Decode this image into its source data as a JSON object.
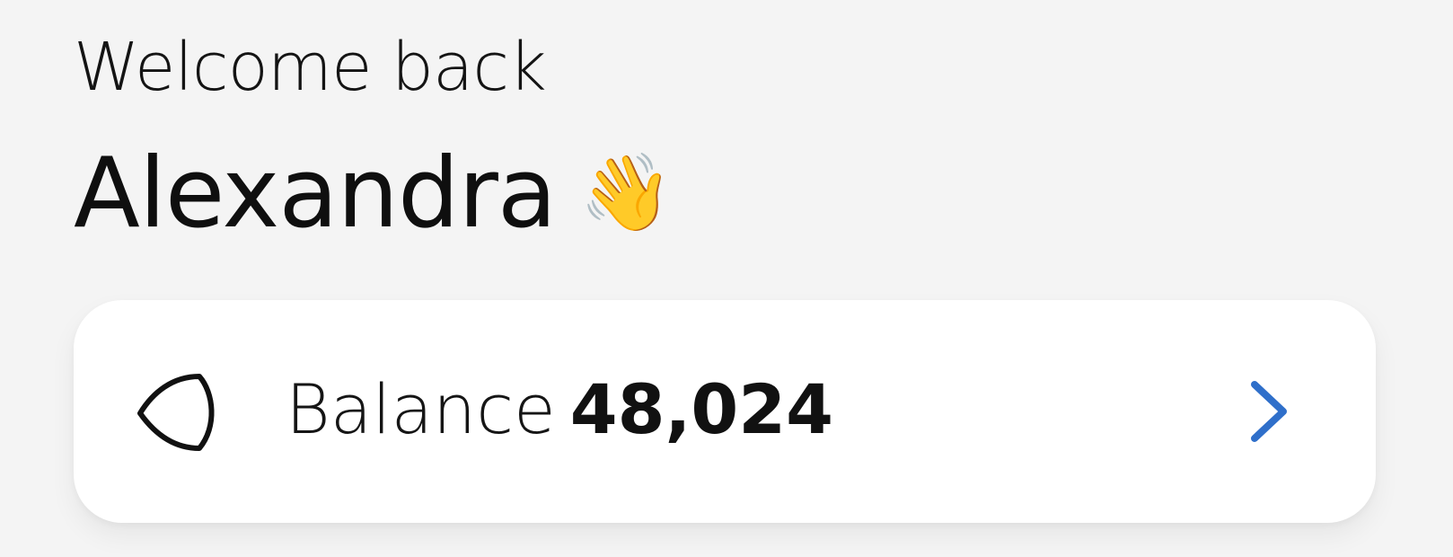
{
  "header": {
    "greeting": "Welcome back",
    "user_name": "Alexandra",
    "wave_emoji": "👋"
  },
  "balance": {
    "label": "Balance",
    "value": "48,024",
    "icon": "token-icon",
    "chevron_icon": "chevron-right-icon",
    "accent_color": "#2f6fca"
  }
}
